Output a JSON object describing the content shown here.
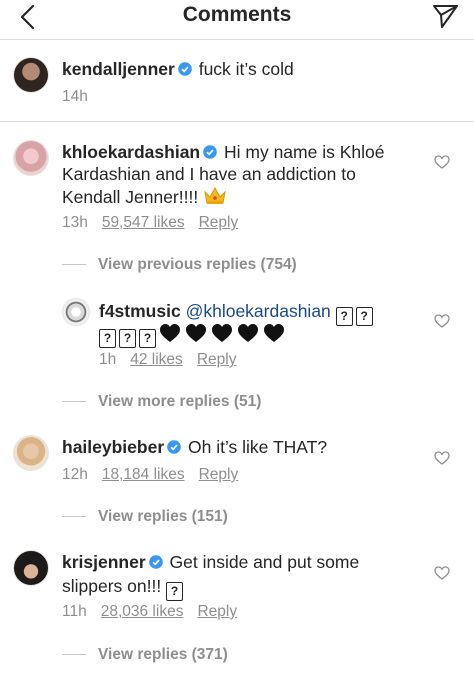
{
  "header": {
    "title": "Comments"
  },
  "caption": {
    "username": "kendalljenner",
    "text": "fuck it’s cold",
    "time": "14h"
  },
  "comments": [
    {
      "username": "khloekardashian",
      "line1": "Hi my name is Khloé",
      "line2": "Kardashian and I have an addiction to",
      "line3": "Kendall Jenner!!!!",
      "time": "13h",
      "likes": "59,547 likes",
      "reply": "Reply",
      "view_replies": "View previous replies (754)"
    },
    {
      "username": "f4stmusic",
      "mention": "@khloekardashian",
      "time": "1h",
      "likes": "42 likes",
      "reply": "Reply",
      "view_replies": "View more replies (51)"
    },
    {
      "username": "haileybieber",
      "text": "Oh it’s like THAT?",
      "time": "12h",
      "likes": "18,184 likes",
      "reply": "Reply",
      "view_replies": "View replies (151)"
    },
    {
      "username": "krisjenner",
      "line1": "Get inside and put some",
      "line2": "slippers on!!!",
      "time": "11h",
      "likes": "28,036 likes",
      "reply": "Reply",
      "view_replies": "View replies (371)"
    }
  ],
  "colors": {
    "text": "#262626",
    "muted": "#8e8e8e",
    "verified": "#3897f0",
    "divider": "#dbdbdb",
    "mention": "#1a4a8a"
  },
  "icons": [
    "back-arrow-icon",
    "send-direct-icon",
    "verified-badge-icon",
    "heart-outline-icon",
    "crown-emoji-icon",
    "black-heart-emoji-icon",
    "missing-glyph-icon"
  ]
}
